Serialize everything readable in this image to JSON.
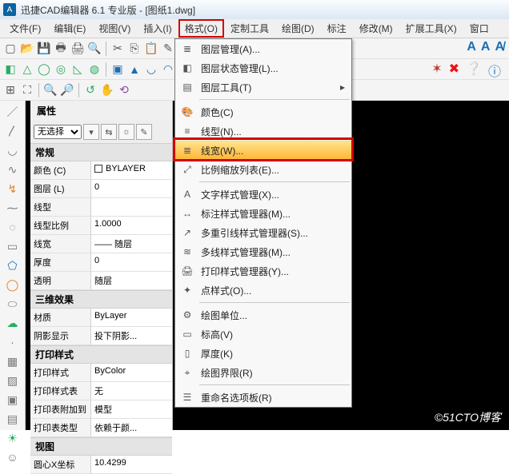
{
  "title": "迅捷CAD编辑器 6.1 专业版 - [图纸1.dwg]",
  "menubar": [
    "文件(F)",
    "编辑(E)",
    "视图(V)",
    "插入(I)",
    "格式(O)",
    "定制工具",
    "绘图(D)",
    "标注",
    "修改(M)",
    "扩展工具(X)",
    "窗口"
  ],
  "dropdown": {
    "layer_mgr": "图层管理(A)...",
    "layer_state": "图层状态管理(L)...",
    "layer_tools": "图层工具(T)",
    "color": "颜色(C)",
    "linetype": "线型(N)...",
    "lineweight": "线宽(W)...",
    "scale_list": "比例缩放列表(E)...",
    "text_style": "文字样式管理(X)...",
    "dim_style": "标注样式管理器(M)...",
    "mleader": "多重引线样式管理器(S)...",
    "mline": "多线样式管理器(M)...",
    "plot_style": "打印样式管理器(Y)...",
    "point_style": "点样式(O)...",
    "units": "绘图单位...",
    "elevation": "标高(V)",
    "thickness": "厚度(K)",
    "limits": "绘图界限(R)",
    "rename": "重命名选项板(R)"
  },
  "prop_panel": {
    "title": "属性",
    "no_selection": "无选择",
    "groups": {
      "general": "常规",
      "effect3d": "三维效果",
      "print": "打印样式",
      "view": "视图"
    },
    "rows": {
      "color": {
        "k": "颜色 (C)",
        "v": "BYLAYER"
      },
      "layer": {
        "k": "图层 (L)",
        "v": "0"
      },
      "linetype": {
        "k": "线型",
        "v": ""
      },
      "ltscale": {
        "k": "线型比例",
        "v": "1.0000"
      },
      "lineweight": {
        "k": "线宽",
        "v": "—— 随层"
      },
      "thickness": {
        "k": "厚度",
        "v": "0"
      },
      "transparent": {
        "k": "透明",
        "v": "随层"
      },
      "material": {
        "k": "材质",
        "v": "ByLayer"
      },
      "shadow": {
        "k": "阴影显示",
        "v": "投下阴影..."
      },
      "pstyle": {
        "k": "打印样式",
        "v": "ByColor"
      },
      "ptable": {
        "k": "打印样式表",
        "v": "无"
      },
      "pattach": {
        "k": "打印表附加到",
        "v": "模型"
      },
      "ptype": {
        "k": "打印表类型",
        "v": "依赖于颜..."
      },
      "centerx": {
        "k": "圆心X坐标",
        "v": "10.4299"
      }
    }
  },
  "watermark": "©51CTO博客"
}
